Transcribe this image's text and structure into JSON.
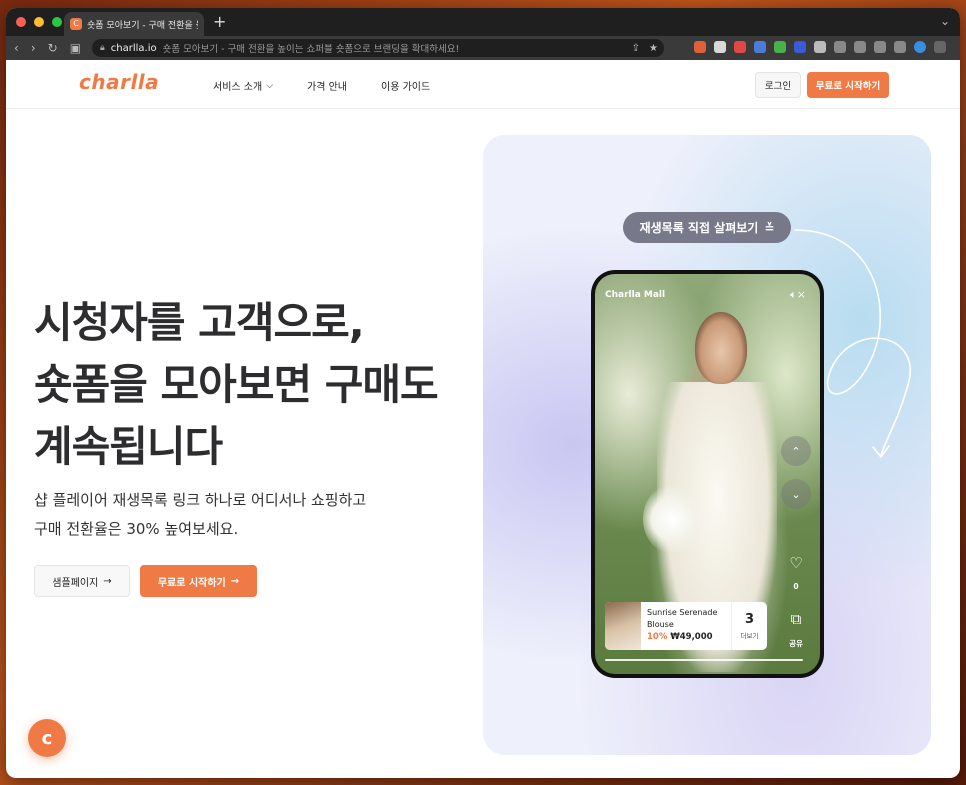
{
  "browser": {
    "tab_title": "숏폼 모아보기 - 구매 전환을 높이는",
    "tab_favicon": "C",
    "new_tab_label": "+",
    "url_domain": "charlla.io",
    "url_path": "숏폼 모아보기 - 구매 전환을 높이는 쇼퍼블 숏폼으로 브랜딩을 확대하세요!"
  },
  "header": {
    "logo": "charlla",
    "nav": [
      {
        "label": "서비스 소개",
        "has_dropdown": true
      },
      {
        "label": "가격 안내"
      },
      {
        "label": "이용 가이드"
      }
    ],
    "login_label": "로그인",
    "start_label": "무료로 시작하기"
  },
  "hero": {
    "title_line1": "시청자를 고객으로,",
    "title_line2": "숏폼을 모아보면 구매도",
    "title_line3": "계속됩니다",
    "sub_line1": "샵 플레이어 재생목록 링크 하나로 어디서나 쇼핑하고",
    "sub_line2": "구매 전환율은 30% 높여보세요.",
    "sample_button": "샘플페이지",
    "start_button": "무료로 시작하기",
    "arrow": "→"
  },
  "showcase": {
    "replay_pill": "재생목록 직접 살펴보기",
    "phone_brand": "Charlla Mall",
    "like_count": "0",
    "share_label": "공유",
    "product": {
      "name": "Sunrise Serenade Blouse",
      "discount": "10%",
      "price": "₩49,000",
      "more_count": "3",
      "more_label": "더보기"
    }
  },
  "floating_button": "c",
  "colors": {
    "accent": "#f07a46",
    "heading": "#2d2d30"
  },
  "icons": {
    "chevron": "chevron-down-icon",
    "mute": "speaker-mute-icon",
    "up": "chevron-up-icon",
    "down": "chevron-down-icon",
    "heart": "heart-icon",
    "share": "share-icon"
  }
}
